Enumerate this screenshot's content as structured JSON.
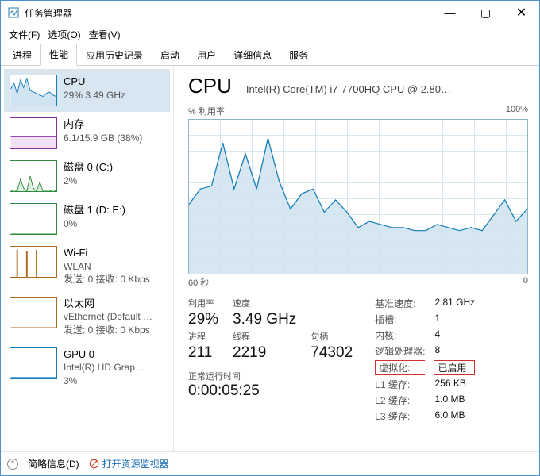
{
  "window": {
    "title": "任务管理器"
  },
  "menus": {
    "file": "文件(F)",
    "options": "选项(O)",
    "view": "查看(V)"
  },
  "tabs": {
    "processes": "进程",
    "performance": "性能",
    "apphistory": "应用历史记录",
    "startup": "启动",
    "users": "用户",
    "details": "详细信息",
    "services": "服务"
  },
  "sidebar": [
    {
      "label": "CPU",
      "sub": "29% 3.49 GHz",
      "color": "#117dbb",
      "fill": "#cfe3f0",
      "spark": [
        0.55,
        0.75,
        0.4,
        0.85,
        0.6,
        0.9,
        0.5,
        0.45,
        0.4,
        0.35,
        0.3,
        0.4,
        0.45,
        0.35,
        0.3
      ]
    },
    {
      "label": "内存",
      "sub": "6.1/15.9 GB (38%)",
      "color": "#8b2fa0",
      "fill": "#efe0f2",
      "spark": [
        0.38,
        0.38,
        0.38,
        0.38,
        0.38,
        0.38,
        0.38,
        0.38,
        0.38,
        0.38,
        0.38,
        0.38,
        0.38,
        0.38,
        0.38
      ]
    },
    {
      "label": "磁盘 0 (C:)",
      "sub": "2%",
      "color": "#2e8b3d",
      "fill": "#def0e0",
      "spark": [
        0,
        0.05,
        0,
        0.4,
        0.1,
        0,
        0.5,
        0.1,
        0,
        0.3,
        0,
        0,
        0,
        0.05,
        0
      ]
    },
    {
      "label": "磁盘 1 (D: E:)",
      "sub": "0%",
      "color": "#2e8b3d",
      "fill": "#def0e0",
      "spark": [
        0,
        0,
        0,
        0,
        0,
        0,
        0,
        0,
        0,
        0,
        0,
        0,
        0,
        0,
        0
      ]
    },
    {
      "label": "Wi-Fi",
      "sub": "WLAN",
      "sub2": "发送: 0 接收: 0 Kbps",
      "color": "#b06a1f",
      "fill": "#f2e6d4",
      "spark": [
        0,
        0,
        0.9,
        0,
        0,
        0.85,
        0,
        0,
        0.9,
        0,
        0,
        0,
        0,
        0,
        0
      ],
      "bars": true
    },
    {
      "label": "以太网",
      "sub": "vEthernet (Default …",
      "sub2": "发送: 0 接收: 0 Kbps",
      "color": "#b06a1f",
      "fill": "#f2e6d4",
      "spark": [
        0,
        0,
        0,
        0,
        0,
        0,
        0,
        0,
        0,
        0,
        0,
        0,
        0,
        0,
        0
      ]
    },
    {
      "label": "GPU 0",
      "sub": "Intel(R) HD Grap…",
      "sub2": "3%",
      "color": "#117dbb",
      "fill": "#cfe3f0",
      "spark": [
        0.03,
        0.03,
        0.03,
        0.03,
        0.03,
        0.03,
        0.03,
        0.03,
        0.03,
        0.03,
        0.03,
        0.03,
        0.03,
        0.03,
        0.03
      ]
    }
  ],
  "main": {
    "heading": "CPU",
    "model": "Intel(R) Core(TM) i7-7700HQ CPU @ 2.80…",
    "chart_label_left": "% 利用率",
    "chart_label_right": "100%",
    "axis_left": "60 秒",
    "axis_right": "0"
  },
  "chart_data": {
    "type": "area",
    "xlabel": "60 秒",
    "ylabel": "% 利用率",
    "ylim": [
      0,
      100
    ],
    "x": [
      60,
      58,
      56,
      54,
      52,
      50,
      48,
      46,
      44,
      42,
      40,
      38,
      36,
      34,
      32,
      30,
      28,
      26,
      24,
      22,
      20,
      18,
      16,
      14,
      12,
      10,
      8,
      6,
      4,
      2,
      0
    ],
    "values": [
      45,
      55,
      57,
      85,
      55,
      78,
      55,
      88,
      60,
      42,
      52,
      55,
      40,
      48,
      40,
      30,
      34,
      32,
      30,
      30,
      28,
      28,
      32,
      30,
      28,
      30,
      28,
      38,
      48,
      34,
      42
    ]
  },
  "stats": {
    "row1": {
      "k1": "利用率",
      "k2": "速度",
      "v1": "29%",
      "v2": "3.49 GHz"
    },
    "row2": {
      "k1": "进程",
      "k2": "线程",
      "k3": "句柄",
      "v1": "211",
      "v2": "2219",
      "v3": "74302"
    },
    "uptime_k": "正常运行时间",
    "uptime_v": "0:00:05:25"
  },
  "info": {
    "base_k": "基准速度:",
    "base_v": "2.81 GHz",
    "sockets_k": "插槽:",
    "sockets_v": "1",
    "cores_k": "内核:",
    "cores_v": "4",
    "lp_k": "逻辑处理器:",
    "lp_v": "8",
    "virt_k": "虚拟化:",
    "virt_v": "已启用",
    "l1_k": "L1 缓存:",
    "l1_v": "256 KB",
    "l2_k": "L2 缓存:",
    "l2_v": "1.0 MB",
    "l3_k": "L3 缓存:",
    "l3_v": "6.0 MB"
  },
  "statusbar": {
    "fewer": "简略信息(D)",
    "monitor": "打开资源监视器"
  }
}
